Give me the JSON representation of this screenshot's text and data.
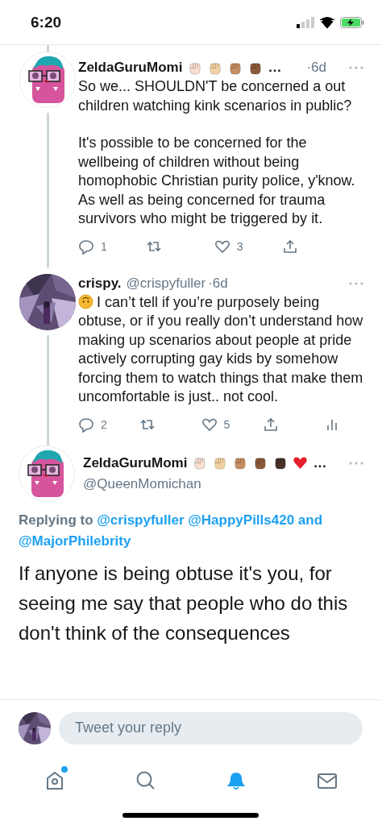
{
  "status_bar": {
    "time": "6:20"
  },
  "thread": [
    {
      "avatar": {
        "kind": "drawing"
      },
      "name": "ZeldaGuruMomi",
      "badges": [
        {
          "kind": "fist",
          "color": "#f7dece"
        },
        {
          "kind": "fist",
          "color": "#f3d2a2"
        },
        {
          "kind": "fist",
          "color": "#c68e62"
        },
        {
          "kind": "fist",
          "color": "#8d5a3a"
        }
      ],
      "name_more": "…",
      "time": "·6d",
      "emoji_lead": false,
      "paragraphs": [
        "So we... SHOULDN'T be concerned a out children watching kink scenarios in public?",
        "It's possible to be concerned for the wellbeing of children without being homophobic Christian purity police, y'know. As well as being concerned for trauma survivors who might be triggered by it."
      ],
      "actions": [
        {
          "kind": "reply",
          "count": "1"
        },
        {
          "kind": "retweet"
        },
        {
          "kind": "like",
          "count": "3"
        },
        {
          "kind": "share"
        }
      ]
    },
    {
      "avatar": {
        "kind": "picture"
      },
      "name": "crispy.",
      "handle": "@crispyfuller",
      "time": "·6d",
      "emoji_lead": true,
      "paragraphs": [
        "I can’t tell if you’re purposely being obtuse, or if you really don’t understand how making up scenarios about people at pride actively corrupting gay kids by somehow forcing them to watch things that make them uncomfortable is just.. not cool."
      ],
      "actions": [
        {
          "kind": "reply",
          "count": "2"
        },
        {
          "kind": "retweet"
        },
        {
          "kind": "like",
          "count": "5"
        },
        {
          "kind": "share"
        },
        {
          "kind": "analytics"
        }
      ]
    }
  ],
  "main_tweet": {
    "name": "ZeldaGuruMomi",
    "badges": [
      {
        "kind": "fist",
        "color": "#f7dece"
      },
      {
        "kind": "fist",
        "color": "#f3d2a2"
      },
      {
        "kind": "fist",
        "color": "#c68e62"
      },
      {
        "kind": "fist",
        "color": "#8d5a3a"
      },
      {
        "kind": "fist",
        "color": "#4a3228"
      },
      {
        "kind": "heart",
        "color": "#e8202e"
      }
    ],
    "name_more": "…",
    "handle": "@QueenMomichan",
    "replying": {
      "label": "Replying to",
      "mentions": [
        "@crispyfuller",
        "@HappyPills420"
      ],
      "joiner": "and",
      "last": "@MajorPhilebrity"
    },
    "text": "If anyone is being obtuse it's you, for seeing me say that people who do this don't think of the consequences"
  },
  "reply_bar": {
    "placeholder": "Tweet your reply"
  },
  "tab_bar": [
    {
      "kind": "home",
      "selected": false,
      "dot": true
    },
    {
      "kind": "search",
      "selected": false,
      "dot": false
    },
    {
      "kind": "notifications",
      "selected": true,
      "dot": false
    },
    {
      "kind": "messages",
      "selected": false,
      "dot": false
    }
  ]
}
